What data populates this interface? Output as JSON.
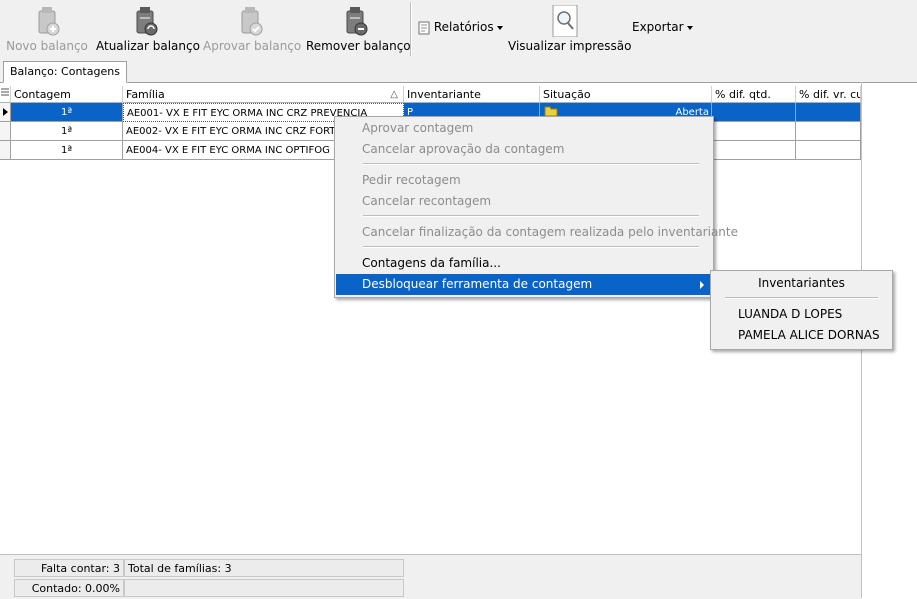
{
  "toolbar": {
    "buttons": [
      {
        "label": "Novo balanço",
        "enabled": false,
        "icon": "new-balance-icon"
      },
      {
        "label": "Atualizar balanço",
        "enabled": true,
        "icon": "refresh-balance-icon"
      },
      {
        "label": "Aprovar balanço",
        "enabled": false,
        "icon": "approve-balance-icon"
      },
      {
        "label": "Remover balanço",
        "enabled": true,
        "icon": "remove-balance-icon"
      }
    ],
    "reports_label": "Relatórios",
    "print_preview_label": "Visualizar impressão",
    "export_label": "Exportar"
  },
  "tab": {
    "label": "Balanço: Contagens"
  },
  "grid": {
    "columns": [
      "Contagem",
      "Família",
      "Inventariante",
      "Situação",
      "% dif. qtd.",
      "% dif. vr. cu"
    ],
    "sort_indicator": "△",
    "rows": [
      {
        "contagem": "1ª",
        "familia": "AE001- VX E FIT EYC ORMA INC CRZ PREVENCIA",
        "inventariante": "P",
        "situacao": "Aberta",
        "selected": true
      },
      {
        "contagem": "1ª",
        "familia": "AE002- VX E FIT EYC ORMA INC CRZ FORTI",
        "inventariante": "",
        "situacao": "",
        "selected": false
      },
      {
        "contagem": "1ª",
        "familia": "AE004- VX E FIT EYC ORMA INC OPTIFOG P",
        "inventariante": "",
        "situacao": "",
        "selected": false
      }
    ]
  },
  "context_menu": {
    "items": [
      {
        "label": "Aprovar contagem",
        "enabled": false
      },
      {
        "label": "Cancelar aprovação da contagem",
        "enabled": false
      },
      {
        "label": "Pedir recotagem",
        "enabled": false
      },
      {
        "label": "Cancelar recontagem",
        "enabled": false
      },
      {
        "label": "Cancelar finalização da contagem realizada pelo inventariante",
        "enabled": false
      },
      {
        "label": "Contagens da família...",
        "enabled": true
      },
      {
        "label": "Desbloquear ferramenta de contagem",
        "enabled": true,
        "highlighted": true
      }
    ]
  },
  "submenu": {
    "header": "Inventariantes",
    "items": [
      "LUANDA D LOPES",
      "PAMELA ALICE DORNAS"
    ]
  },
  "footer": {
    "falta_contar": "Falta contar: 3",
    "total_familias": "Total de famílias: 3",
    "contado": "Contado: 0.00%"
  },
  "colors": {
    "selection": "#0a64c8",
    "toolbar_bg": "#f0f0f0"
  }
}
